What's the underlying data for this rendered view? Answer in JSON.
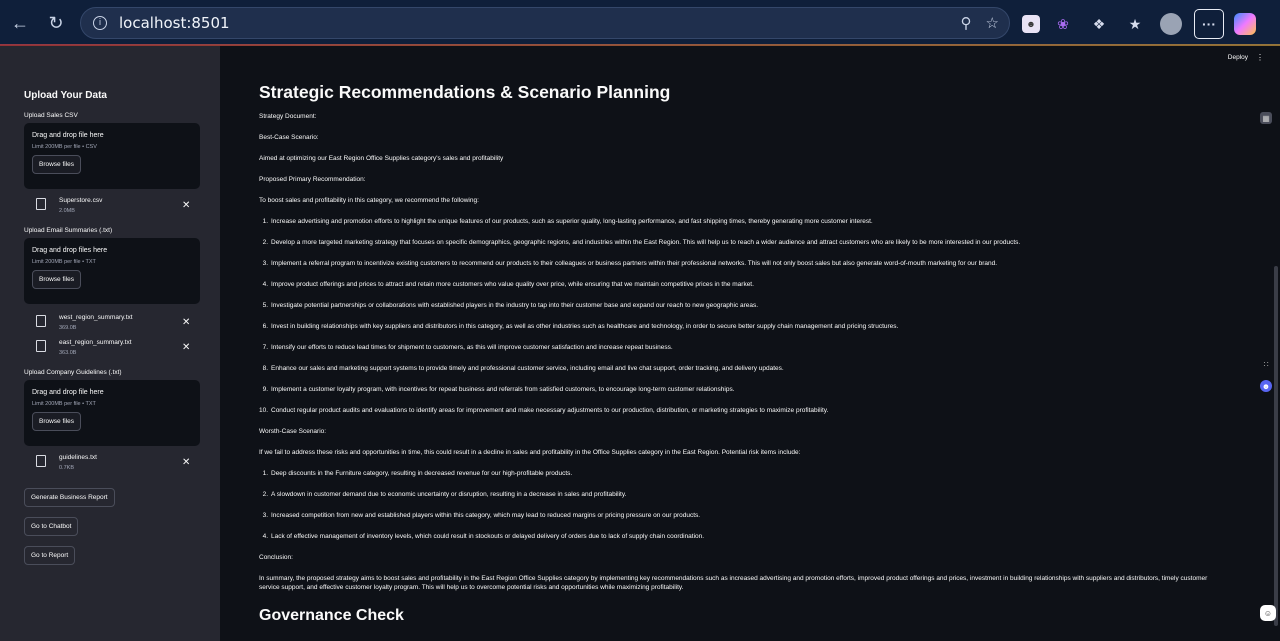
{
  "browser": {
    "url": "localhost:8501"
  },
  "header": {
    "deploy_label": "Deploy"
  },
  "sidebar": {
    "title": "Upload Your Data",
    "sales": {
      "label": "Upload Sales CSV",
      "drop_text": "Drag and drop file here",
      "limit": "Limit 200MB per file • CSV",
      "browse": "Browse files",
      "files": [
        {
          "name": "Superstore.csv",
          "size": "2.0MB"
        }
      ]
    },
    "email": {
      "label": "Upload Email Summaries (.txt)",
      "drop_text": "Drag and drop files here",
      "limit": "Limit 200MB per file • TXT",
      "browse": "Browse files",
      "files": [
        {
          "name": "west_region_summary.txt",
          "size": "369.0B"
        },
        {
          "name": "east_region_summary.txt",
          "size": "363.0B"
        }
      ]
    },
    "guidelines": {
      "label": "Upload Company Guidelines (.txt)",
      "drop_text": "Drag and drop file here",
      "limit": "Limit 200MB per file • TXT",
      "browse": "Browse files",
      "files": [
        {
          "name": "guidelines.txt",
          "size": "0.7KB"
        }
      ]
    },
    "buttons": {
      "generate": "Generate Business Report",
      "chatbot": "Go to Chatbot",
      "report": "Go to Report"
    }
  },
  "main": {
    "title": "Strategic Recommendations & Scenario Planning",
    "strategy_doc": "Strategy Document:",
    "best_case": "Best-Case Scenario:",
    "aim": "Aimed at optimizing our East Region Office Supplies category's sales and profitability",
    "proposed": "Proposed Primary Recommendation:",
    "intro": "To boost sales and profitability in this category, we recommend the following:",
    "recommendations": [
      "Increase advertising and promotion efforts to highlight the unique features of our products, such as superior quality, long-lasting performance, and fast shipping times, thereby generating more customer interest.",
      "Develop a more targeted marketing strategy that focuses on specific demographics, geographic regions, and industries within the East Region. This will help us to reach a wider audience and attract customers who are likely to be more interested in our products.",
      "Implement a referral program to incentivize existing customers to recommend our products to their colleagues or business partners within their professional networks. This will not only boost sales but also generate word-of-mouth marketing for our brand.",
      "Improve product offerings and prices to attract and retain more customers who value quality over price, while ensuring that we maintain competitive prices in the market.",
      "Investigate potential partnerships or collaborations with established players in the industry to tap into their customer base and expand our reach to new geographic areas.",
      "Invest in building relationships with key suppliers and distributors in this category, as well as other industries such as healthcare and technology, in order to secure better supply chain management and pricing structures.",
      "Intensify our efforts to reduce lead times for shipment to customers, as this will improve customer satisfaction and increase repeat business.",
      "Enhance our sales and marketing support systems to provide timely and professional customer service, including email and live chat support, order tracking, and delivery updates.",
      "Implement a customer loyalty program, with incentives for repeat business and referrals from satisfied customers, to encourage long-term customer relationships.",
      "Conduct regular product audits and evaluations to identify areas for improvement and make necessary adjustments to our production, distribution, or marketing strategies to maximize profitability."
    ],
    "worst_case": "Worsth-Case Scenario:",
    "worst_intro": "If we fail to address these risks and opportunities in time, this could result in a decline in sales and profitability in the Office Supplies category in the East Region. Potential risk items include:",
    "risks": [
      "Deep discounts in the Furniture category, resulting in decreased revenue for our high-profitable products.",
      "A slowdown in customer demand due to economic uncertainty or disruption, resulting in a decrease in sales and profitability.",
      "Increased competition from new and established players within this category, which may lead to reduced margins or pricing pressure on our products.",
      "Lack of effective management of inventory levels, which could result in stockouts or delayed delivery of orders due to lack of supply chain coordination."
    ],
    "conclusion_label": "Conclusion:",
    "conclusion": "In summary, the proposed strategy aims to boost sales and profitability in the East Region Office Supplies category by implementing key recommendations such as increased advertising and promotion efforts, improved product offerings and prices, investment in building relationships with suppliers and distributors, timely customer service support, and effective customer loyalty program. This will help us to overcome potential risks and opportunities while maximizing profitability.",
    "governance_title": "Governance Check"
  }
}
